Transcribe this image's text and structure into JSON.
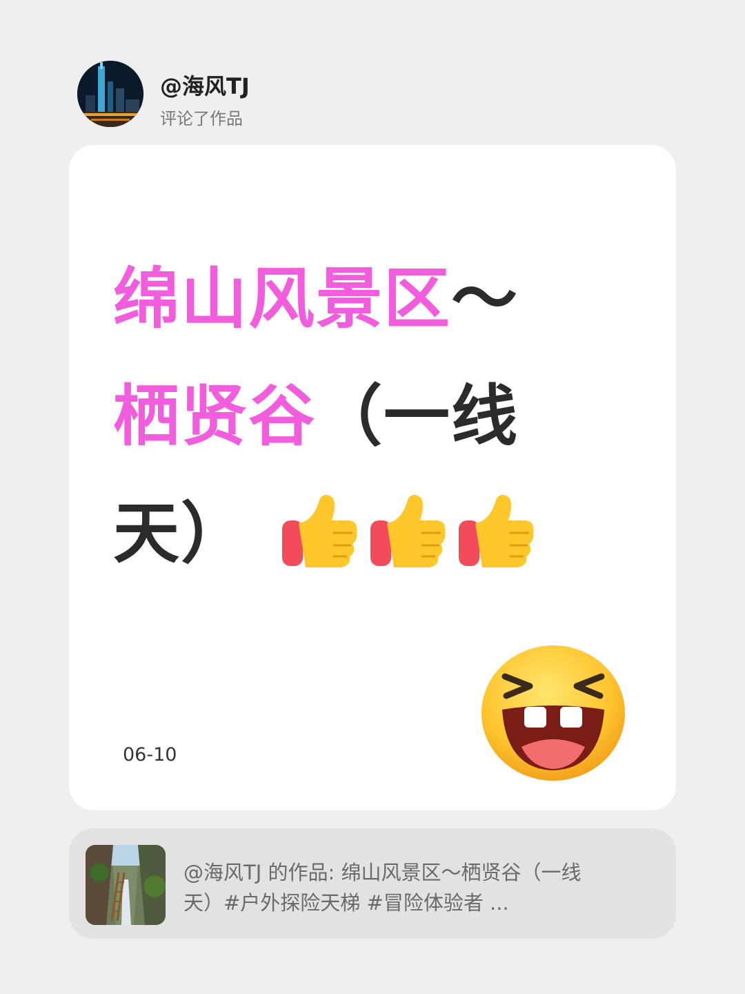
{
  "header": {
    "username": "@海风TJ",
    "action": "评论了作品"
  },
  "comment": {
    "pink_text": "绵山风景区",
    "dark_line1_tail": "～",
    "pink_line2": "栖贤谷",
    "dark_line2_tail": "（一线",
    "dark_line3": "天）",
    "date": "06-10",
    "icons": [
      "thumbs-up-icon",
      "thumbs-up-icon",
      "thumbs-up-icon",
      "laughing-face-icon"
    ]
  },
  "source": {
    "line1": "@海风TJ 的作品: 绵山风景区～栖贤谷（一线",
    "line2": "天）#户外探险天梯 #冒险体验者 ..."
  },
  "colors": {
    "background": "#efefef",
    "card": "#ffffff",
    "accent_pink": "#f25ddd",
    "text_dark": "#2b2b2b",
    "source_bg": "#e2e2e2"
  }
}
